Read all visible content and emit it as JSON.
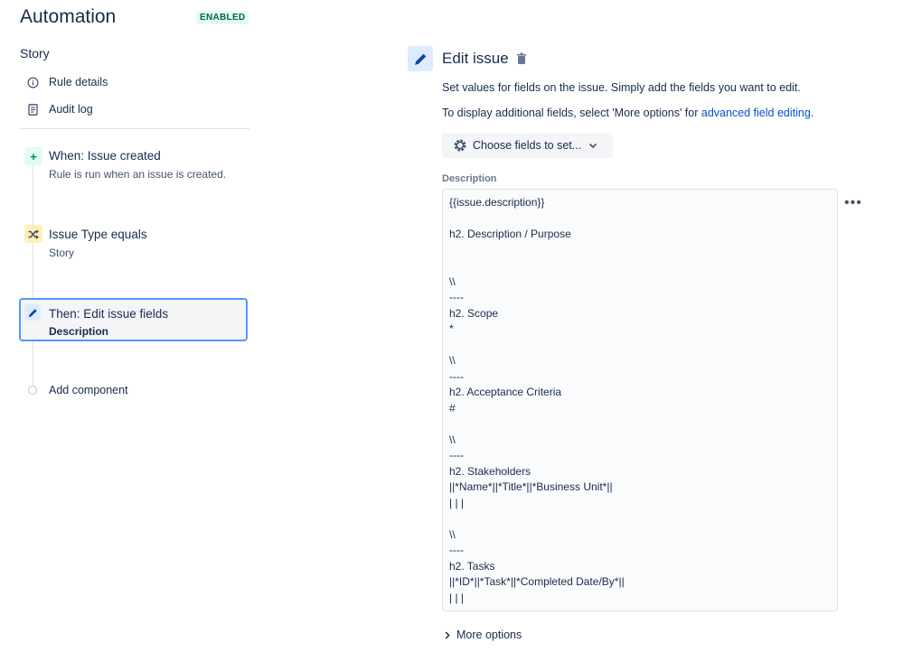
{
  "header": {
    "title": "Automation",
    "status": "ENABLED"
  },
  "sidebar": {
    "rule_name": "Story",
    "nav": [
      {
        "label": "Rule details",
        "icon": "info-icon"
      },
      {
        "label": "Audit log",
        "icon": "document-icon"
      }
    ],
    "steps": [
      {
        "title": "When: Issue created",
        "subtitle": "Rule is run when an issue is created.",
        "icon": "plus-icon",
        "color": "#e3fcef"
      },
      {
        "title": "Issue Type equals",
        "subtitle": "Story",
        "icon": "shuffle-icon",
        "color": "#fff0b3"
      },
      {
        "title": "Then: Edit issue fields",
        "subtitle": "Description",
        "icon": "pencil-icon",
        "color": "#deebff"
      }
    ],
    "add_component": "Add component"
  },
  "action": {
    "title": "Edit issue",
    "description": "Set values for fields on the issue. Simply add the fields you want to edit.",
    "advanced_prefix": "To display additional fields, select 'More options' for ",
    "advanced_link": "advanced field editing",
    "advanced_suffix": ".",
    "choose_fields": "Choose fields to set...",
    "field_label": "Description",
    "field_value": "{{issue.description}}\n\nh2. Description / Purpose\n\n\n\\\\\n----\nh2. Scope\n*\n\n\\\\\n----\nh2. Acceptance Criteria\n#\n\n\\\\\n----\nh2. Stakeholders\n||*Name*||*Title*||*Business Unit*||\n| | |\n\n\\\\\n----\nh2. Tasks\n||*ID*||*Task*||*Completed Date/By*||\n| | |",
    "more_options": "More options"
  },
  "colors": {
    "accent": "#0052cc",
    "selected_border": "#4c9aff",
    "enabled_bg": "#e3fcef",
    "enabled_text": "#006644"
  }
}
